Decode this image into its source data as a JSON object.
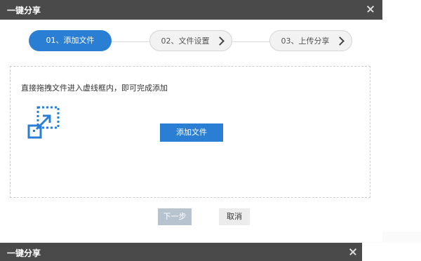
{
  "dialog": {
    "title": "一键分享",
    "steps": [
      {
        "label": "01、添加文件",
        "state": "active"
      },
      {
        "label": "02、文件设置",
        "state": "inactive"
      },
      {
        "label": "03、上传分享",
        "state": "inactive"
      }
    ],
    "dropzone": {
      "hint": "直接拖拽文件进入虚线框内，即可完成添加",
      "icon": "drag-drop-icon",
      "add_button": "添加文件"
    },
    "footer": {
      "next_label": "下一步",
      "cancel_label": "取消"
    }
  },
  "second_dialog": {
    "title": "一键分享"
  },
  "colors": {
    "accent": "#2a7fd4",
    "titlebar": "#4a4a4a",
    "disabled": "#b7c3cf"
  }
}
